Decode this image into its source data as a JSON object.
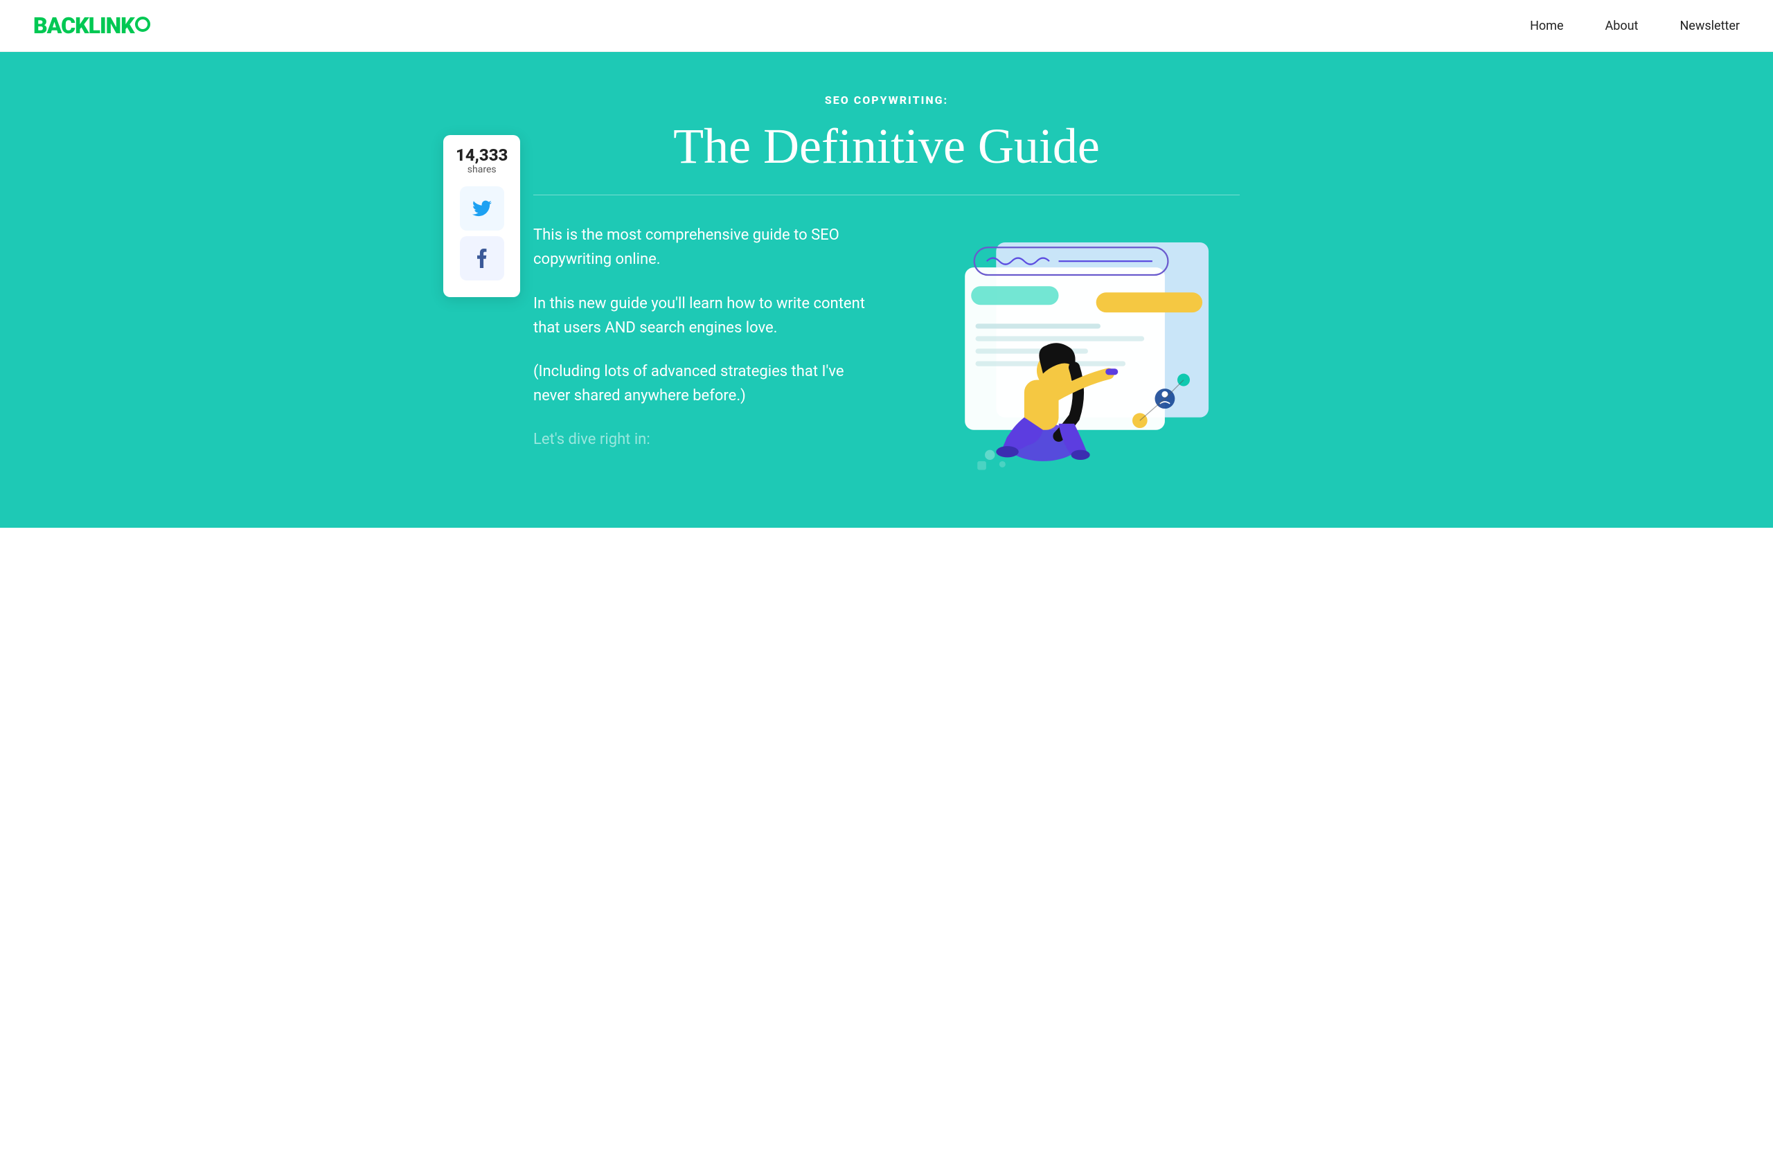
{
  "header": {
    "logo_text": "BACKLINK",
    "nav": {
      "home": "Home",
      "about": "About",
      "newsletter": "Newsletter"
    }
  },
  "hero": {
    "subtitle": "SEO COPYWRITING:",
    "title": "The Definitive Guide",
    "share_count": "14,333",
    "share_label": "shares",
    "para1": "This is the most comprehensive guide to SEO copywriting online.",
    "para2": "In this new guide you'll learn how to write content that users AND search engines love.",
    "para3": "(Including lots of advanced strategies that I've never shared anywhere before.)",
    "fade_text": "Let's dive right in:"
  },
  "colors": {
    "brand_green": "#00c853",
    "hero_teal": "#1ec9b5",
    "twitter_blue": "#1da1f2",
    "facebook_blue": "#3b5998"
  }
}
